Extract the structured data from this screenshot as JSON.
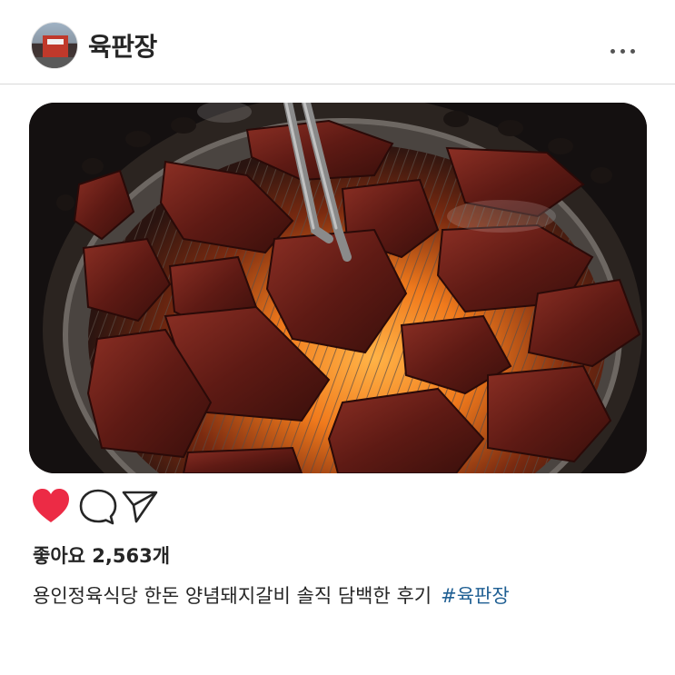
{
  "post": {
    "username": "육판장",
    "likes_text": "좋아요 2,563개",
    "caption": "용인정육식당 한돈 양념돼지갈비 솔직 담백한 후기",
    "hashtag": "#육판장"
  },
  "icons": {
    "like": "heart-icon",
    "comment": "comment-bubble-icon",
    "share": "paper-plane-icon",
    "more": "more-options-icon"
  },
  "colors": {
    "heart": "#ec2b45",
    "hashtag": "#1f5f93",
    "text": "#262626",
    "divider": "#d9d9d9"
  },
  "state": {
    "liked": true
  }
}
